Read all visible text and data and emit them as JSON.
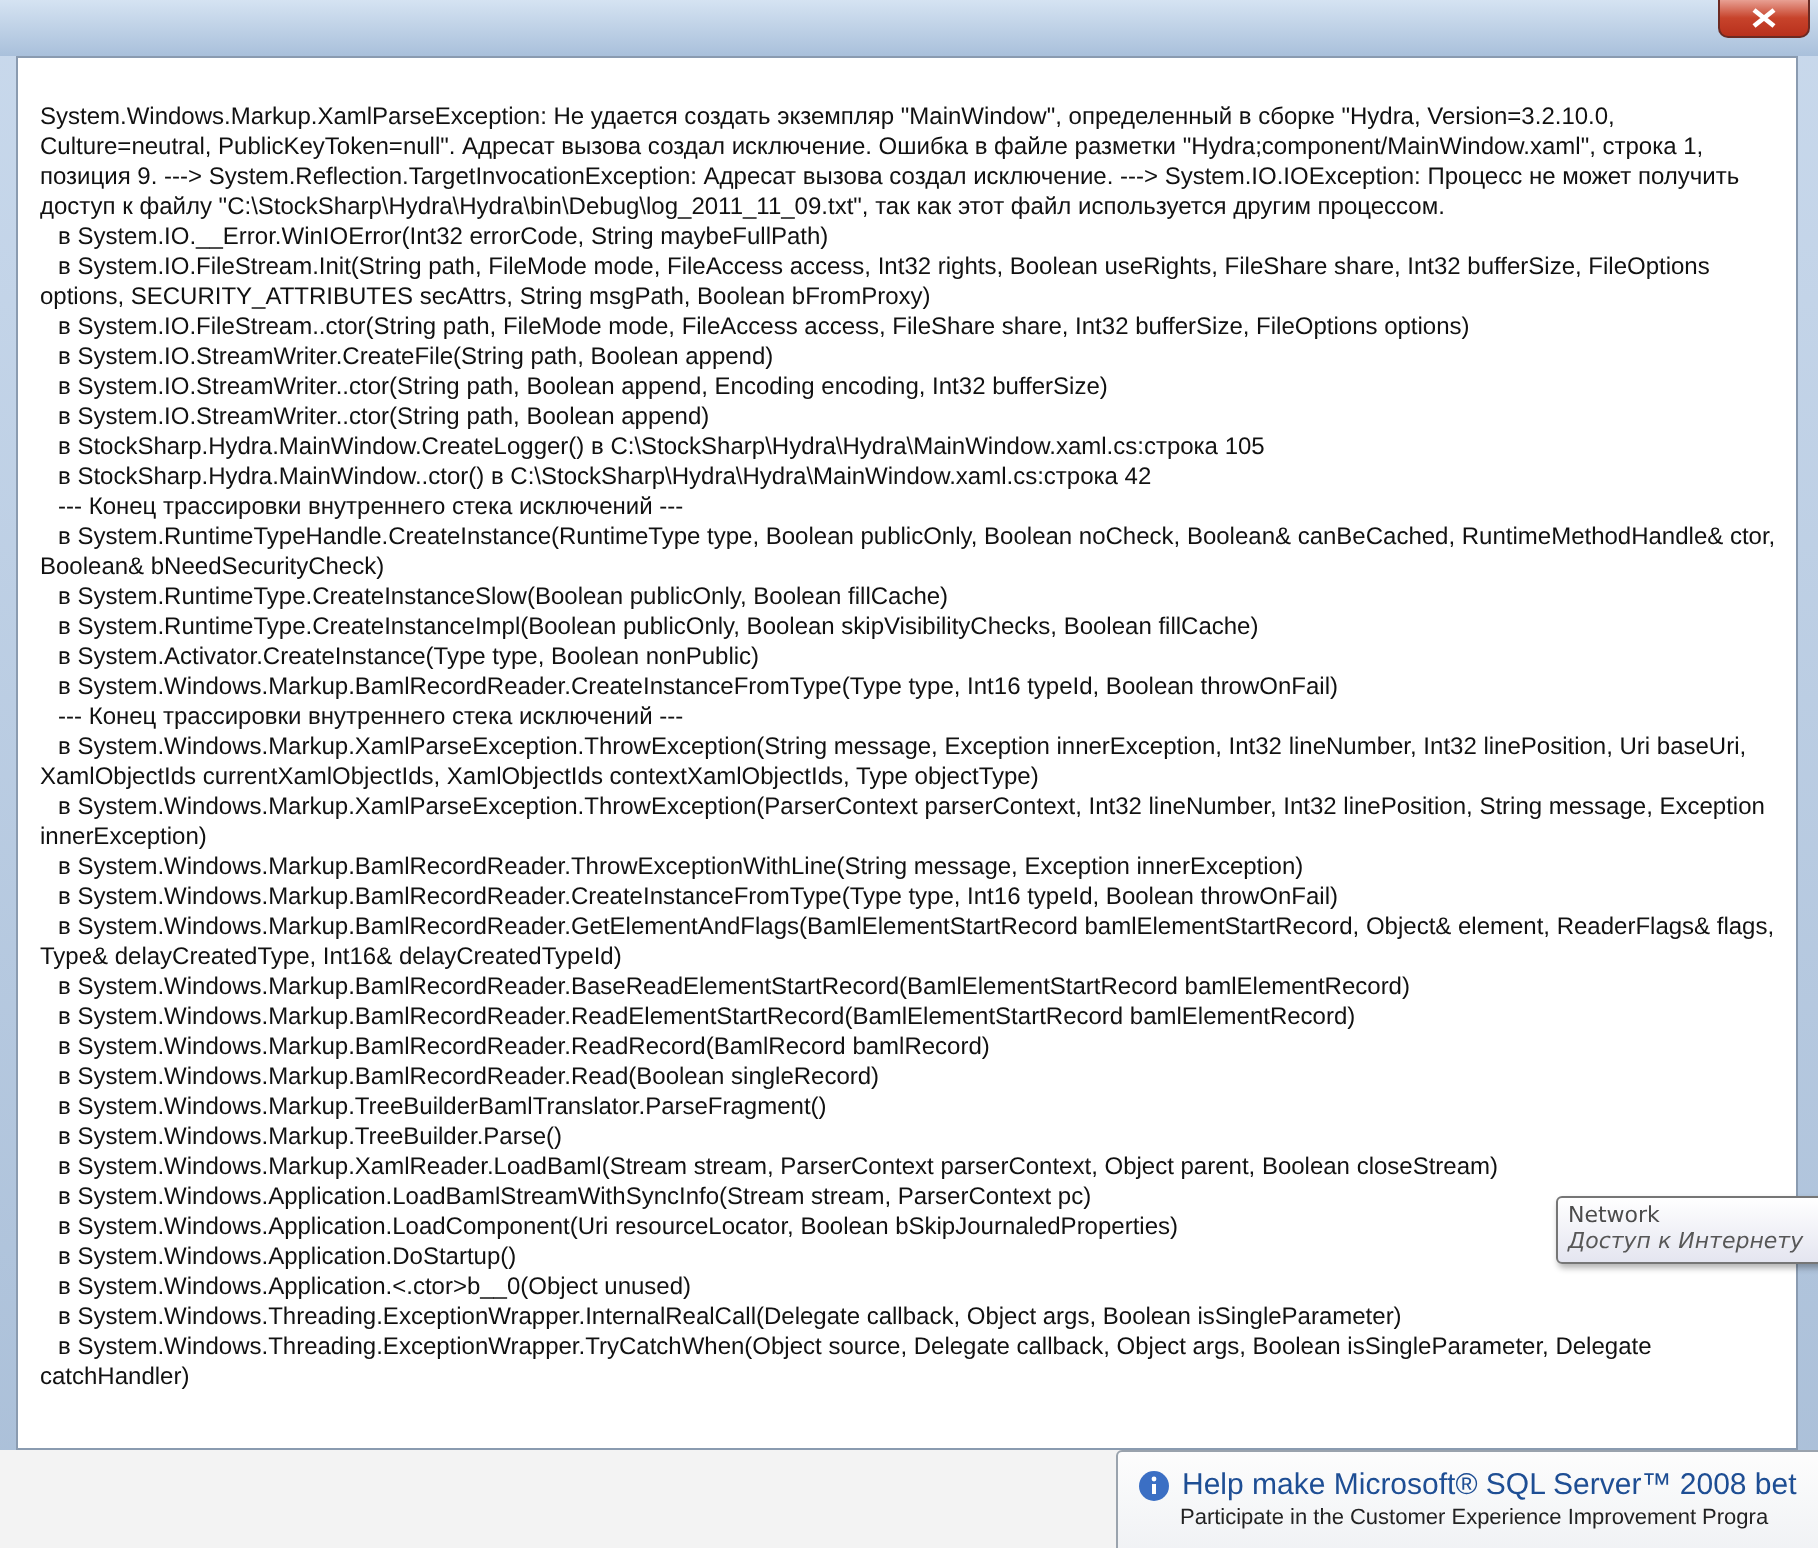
{
  "message": {
    "lines": [
      {
        "kind": "head",
        "text": "System.Windows.Markup.XamlParseException: Не удается создать экземпляр \"MainWindow\", определенный в сборке \"Hydra, Version=3.2.10.0, Culture=neutral, PublicKeyToken=null\". Адресат вызова создал исключение.  Ошибка в файле разметки \"Hydra;component/MainWindow.xaml\", строка 1, позиция 9. ---> System.Reflection.TargetInvocationException: Адресат вызова создал исключение. ---> System.IO.IOException: Процесс не может получить доступ к файлу \"C:\\StockSharp\\Hydra\\Hydra\\bin\\Debug\\log_2011_11_09.txt\", так как этот файл используется другим процессом."
      },
      {
        "kind": "frame",
        "text": "в System.IO.__Error.WinIOError(Int32 errorCode, String maybeFullPath)"
      },
      {
        "kind": "frame",
        "text": "в System.IO.FileStream.Init(String path, FileMode mode, FileAccess access, Int32 rights, Boolean useRights, FileShare share, Int32 bufferSize, FileOptions options, SECURITY_ATTRIBUTES secAttrs, String msgPath, Boolean bFromProxy)"
      },
      {
        "kind": "frame",
        "text": "в System.IO.FileStream..ctor(String path, FileMode mode, FileAccess access, FileShare share, Int32 bufferSize, FileOptions options)"
      },
      {
        "kind": "frame",
        "text": "в System.IO.StreamWriter.CreateFile(String path, Boolean append)"
      },
      {
        "kind": "frame",
        "text": "в System.IO.StreamWriter..ctor(String path, Boolean append, Encoding encoding, Int32 bufferSize)"
      },
      {
        "kind": "frame",
        "text": "в System.IO.StreamWriter..ctor(String path, Boolean append)"
      },
      {
        "kind": "frame",
        "text": "в StockSharp.Hydra.MainWindow.CreateLogger() в C:\\StockSharp\\Hydra\\Hydra\\MainWindow.xaml.cs:строка 105"
      },
      {
        "kind": "frame",
        "text": "в StockSharp.Hydra.MainWindow..ctor() в C:\\StockSharp\\Hydra\\Hydra\\MainWindow.xaml.cs:строка 42"
      },
      {
        "kind": "separator",
        "text": "--- Конец трассировки внутреннего стека исключений ---"
      },
      {
        "kind": "frame",
        "text": "в System.RuntimeTypeHandle.CreateInstance(RuntimeType type, Boolean publicOnly, Boolean noCheck, Boolean& canBeCached, RuntimeMethodHandle& ctor, Boolean& bNeedSecurityCheck)"
      },
      {
        "kind": "frame",
        "text": "в System.RuntimeType.CreateInstanceSlow(Boolean publicOnly, Boolean fillCache)"
      },
      {
        "kind": "frame",
        "text": "в System.RuntimeType.CreateInstanceImpl(Boolean publicOnly, Boolean skipVisibilityChecks, Boolean fillCache)"
      },
      {
        "kind": "frame",
        "text": "в System.Activator.CreateInstance(Type type, Boolean nonPublic)"
      },
      {
        "kind": "frame",
        "text": "в System.Windows.Markup.BamlRecordReader.CreateInstanceFromType(Type type, Int16 typeId, Boolean throwOnFail)"
      },
      {
        "kind": "separator",
        "text": "--- Конец трассировки внутреннего стека исключений ---"
      },
      {
        "kind": "frame",
        "text": "в System.Windows.Markup.XamlParseException.ThrowException(String message, Exception innerException, Int32 lineNumber, Int32 linePosition, Uri baseUri, XamlObjectIds currentXamlObjectIds, XamlObjectIds contextXamlObjectIds, Type objectType)"
      },
      {
        "kind": "frame",
        "text": "в System.Windows.Markup.XamlParseException.ThrowException(ParserContext parserContext, Int32 lineNumber, Int32 linePosition, String message, Exception innerException)"
      },
      {
        "kind": "frame",
        "text": "в System.Windows.Markup.BamlRecordReader.ThrowExceptionWithLine(String message, Exception innerException)"
      },
      {
        "kind": "frame",
        "text": "в System.Windows.Markup.BamlRecordReader.CreateInstanceFromType(Type type, Int16 typeId, Boolean throwOnFail)"
      },
      {
        "kind": "frame",
        "text": "в System.Windows.Markup.BamlRecordReader.GetElementAndFlags(BamlElementStartRecord bamlElementStartRecord, Object& element, ReaderFlags& flags, Type& delayCreatedType, Int16& delayCreatedTypeId)"
      },
      {
        "kind": "frame",
        "text": "в System.Windows.Markup.BamlRecordReader.BaseReadElementStartRecord(BamlElementStartRecord bamlElementRecord)"
      },
      {
        "kind": "frame",
        "text": "в System.Windows.Markup.BamlRecordReader.ReadElementStartRecord(BamlElementStartRecord bamlElementRecord)"
      },
      {
        "kind": "frame",
        "text": "в System.Windows.Markup.BamlRecordReader.ReadRecord(BamlRecord bamlRecord)"
      },
      {
        "kind": "frame",
        "text": "в System.Windows.Markup.BamlRecordReader.Read(Boolean singleRecord)"
      },
      {
        "kind": "frame",
        "text": "в System.Windows.Markup.TreeBuilderBamlTranslator.ParseFragment()"
      },
      {
        "kind": "frame",
        "text": "в System.Windows.Markup.TreeBuilder.Parse()"
      },
      {
        "kind": "frame",
        "text": "в System.Windows.Markup.XamlReader.LoadBaml(Stream stream, ParserContext parserContext, Object parent, Boolean closeStream)"
      },
      {
        "kind": "frame",
        "text": "в System.Windows.Application.LoadBamlStreamWithSyncInfo(Stream stream, ParserContext pc)"
      },
      {
        "kind": "frame",
        "text": "в System.Windows.Application.LoadComponent(Uri resourceLocator, Boolean bSkipJournaledProperties)"
      },
      {
        "kind": "frame",
        "text": "в System.Windows.Application.DoStartup()"
      },
      {
        "kind": "frame",
        "text": "в System.Windows.Application.<.ctor>b__0(Object unused)"
      },
      {
        "kind": "frame",
        "text": "в System.Windows.Threading.ExceptionWrapper.InternalRealCall(Delegate callback, Object args, Boolean isSingleParameter)"
      },
      {
        "kind": "frame",
        "text": "в System.Windows.Threading.ExceptionWrapper.TryCatchWhen(Object source, Delegate callback, Object args, Boolean isSingleParameter, Delegate catchHandler)"
      }
    ]
  },
  "tooltip": {
    "title": "Network",
    "subtitle": "Доступ к Интернету"
  },
  "notification": {
    "title": "Help make Microsoft® SQL Server™ 2008 bet",
    "text": "Participate in the Customer Experience Improvement Progra"
  }
}
